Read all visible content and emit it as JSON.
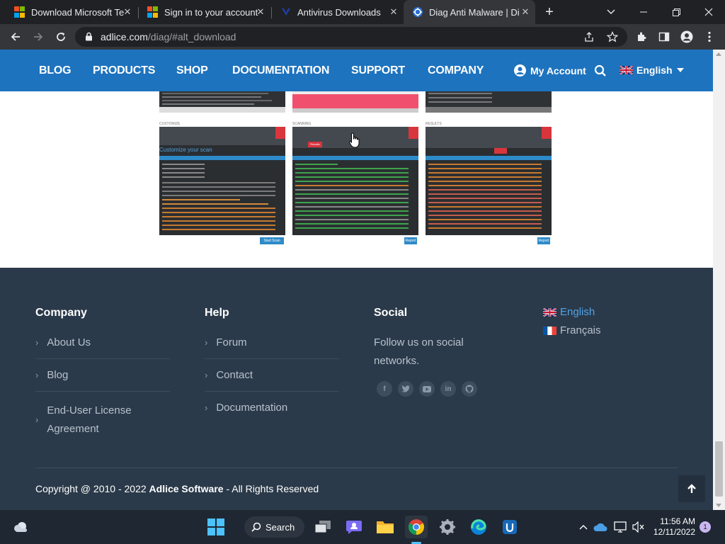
{
  "browser": {
    "tabs": [
      {
        "title": "Download Microsoft Te",
        "active": false,
        "icon": "microsoft-icon"
      },
      {
        "title": "Sign in to your account",
        "active": false,
        "icon": "microsoft-icon"
      },
      {
        "title": "Antivirus Downloads",
        "active": false,
        "icon": "antivirus-icon"
      },
      {
        "title": "Diag Anti Malware | Di",
        "active": true,
        "icon": "adlice-icon"
      }
    ],
    "url_host": "adlice.com",
    "url_path": "/diag/#alt_download"
  },
  "site_nav": {
    "links": [
      "BLOG",
      "PRODUCTS",
      "SHOP",
      "DOCUMENTATION",
      "SUPPORT",
      "COMPANY"
    ],
    "account_label": "My Account",
    "language_label": "English"
  },
  "gallery": {
    "captions": [
      "CUSTOMIZE",
      "SCANNING",
      "RESULTS"
    ],
    "customize_title": "Customize your scan",
    "start_label": "Start Scan",
    "report_label": "Report",
    "tab_label": "Results"
  },
  "footer": {
    "company": {
      "heading": "Company",
      "links": [
        "About Us",
        "Blog",
        "End-User License Agreement"
      ]
    },
    "help": {
      "heading": "Help",
      "links": [
        "Forum",
        "Contact",
        "Documentation"
      ]
    },
    "social": {
      "heading": "Social",
      "text": "Follow us on social networks.",
      "icons": [
        "facebook-icon",
        "twitter-icon",
        "youtube-icon",
        "linkedin-icon",
        "github-icon"
      ]
    },
    "languages": [
      "English",
      "Français"
    ],
    "copyright_prefix": "Copyright @ 2010 - 2022 ",
    "copyright_company": "Adlice Software",
    "copyright_suffix": " - All Rights Reserved"
  },
  "taskbar": {
    "search_label": "Search",
    "time": "11:56 AM",
    "date": "12/11/2022",
    "notification_count": "1"
  },
  "colors": {
    "nav_blue": "#1e73be",
    "footer_bg": "#2b3a4a",
    "taskbar_bg": "#1f2732"
  }
}
